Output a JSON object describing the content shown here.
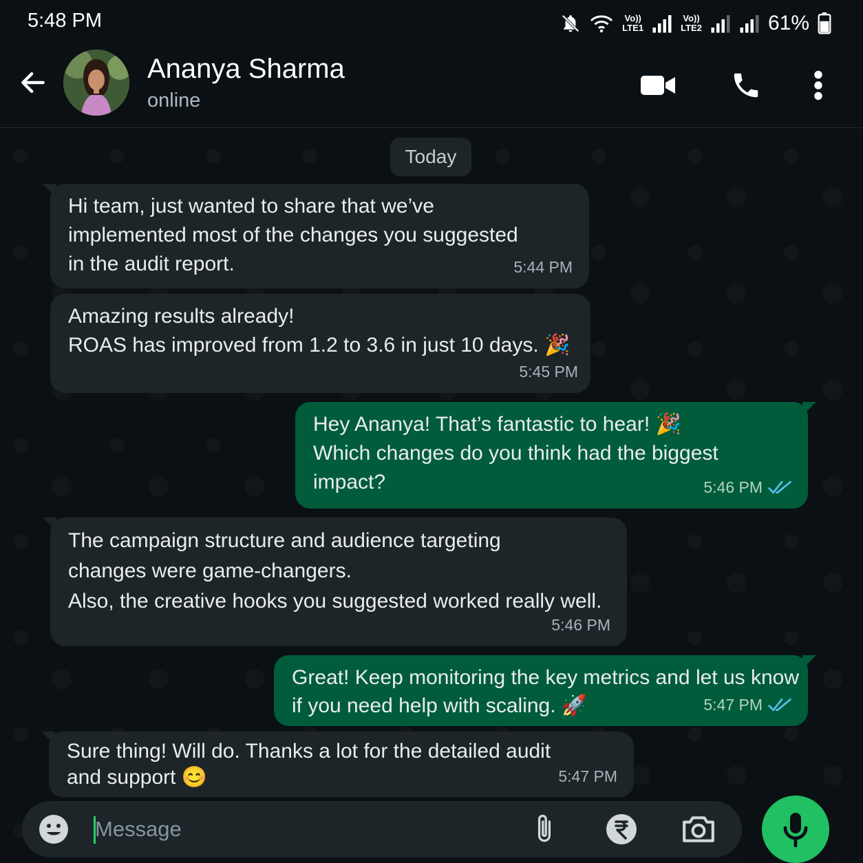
{
  "status_bar": {
    "time": "5:48 PM",
    "sim1_top": "Vo))",
    "sim1_bottom": "LTE1",
    "sim2_top": "Vo))",
    "sim2_bottom": "LTE2",
    "battery": "61%",
    "icons": [
      "mute-bell-icon",
      "wifi-icon",
      "signal-icon",
      "signal-icon",
      "signal-icon",
      "battery-icon"
    ]
  },
  "header": {
    "contact_name": "Ananya Sharma",
    "contact_status": "online",
    "icons": [
      "back-arrow-icon",
      "video-call-icon",
      "phone-icon",
      "more-vertical-icon"
    ]
  },
  "chat": {
    "date_chip": "Today",
    "messages": [
      {
        "direction": "in",
        "text": "Hi team, just wanted to share that we’ve\nimplemented most of the changes you suggested\nin the audit report.",
        "time": "5:44 PM"
      },
      {
        "direction": "in",
        "text": "Amazing results already!\nROAS has improved from 1.2 to 3.6 in just 10 days. 🎉",
        "time": "5:45 PM"
      },
      {
        "direction": "out",
        "text": "Hey Ananya! That’s fantastic to hear! 🎉\nWhich changes do you think had the biggest\nimpact?",
        "time": "5:46 PM",
        "read": true
      },
      {
        "direction": "in",
        "text": "The campaign structure and audience targeting\nchanges were game-changers.\nAlso, the creative hooks you suggested worked really well.",
        "time": "5:46 PM"
      },
      {
        "direction": "out",
        "text": "Great! Keep monitoring the key metrics and let us know\nif you need help with scaling. 🚀",
        "time": "5:47 PM",
        "read": true
      },
      {
        "direction": "in",
        "text": "Sure thing! Will do. Thanks a lot for the detailed audit\nand support 😊",
        "time": "5:47 PM"
      }
    ]
  },
  "composer": {
    "placeholder": "Message",
    "icons": [
      "emoji-icon",
      "attach-icon",
      "rupee-payment-icon",
      "camera-icon",
      "mic-icon"
    ]
  },
  "colors": {
    "background": "#0b1014",
    "incoming_bubble": "#1d2529",
    "outgoing_bubble": "#005c3b",
    "accent_green": "#21c063",
    "read_ticks": "#53bdeb"
  }
}
